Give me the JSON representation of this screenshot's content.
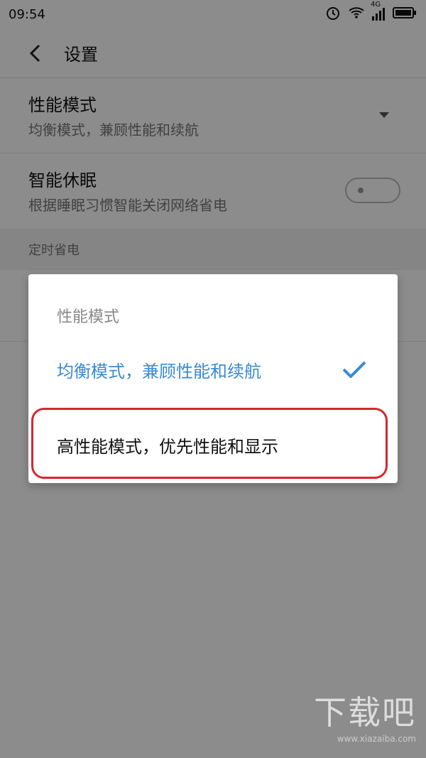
{
  "status": {
    "time": "09:54",
    "network": "4G"
  },
  "appbar": {
    "title": "设置"
  },
  "settings": {
    "performance": {
      "label": "性能模式",
      "value": "均衡模式，兼顾性能和续航"
    },
    "smart_sleep": {
      "label": "智能休眠",
      "desc": "根据睡眠习惯智能关闭网络省电",
      "enabled": false
    },
    "section_title": "定时省电"
  },
  "dialog": {
    "title": "性能模式",
    "options": [
      {
        "label": "均衡模式，兼顾性能和续航",
        "selected": true
      },
      {
        "label": "高性能模式，优先性能和显示",
        "selected": false
      }
    ]
  },
  "watermark": {
    "text": "下载吧",
    "url": "www.xiazaiba.com"
  },
  "colors": {
    "accent": "#3a8ad3",
    "highlight": "#d7262f"
  }
}
